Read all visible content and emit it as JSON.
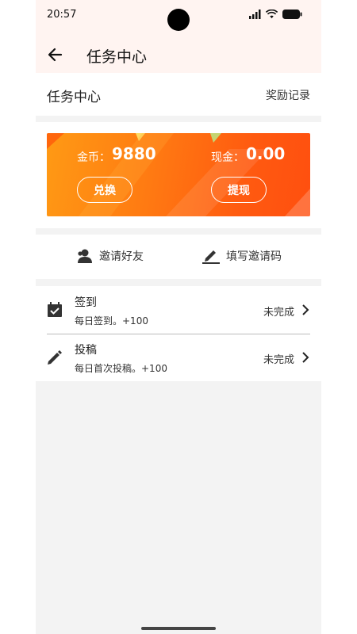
{
  "status_bar": {
    "time": "20:57"
  },
  "app_bar": {
    "title": "任务中心"
  },
  "header": {
    "title": "任务中心",
    "reward_link": "奖励记录"
  },
  "wallet": {
    "coin_label": "金币：",
    "coin_value": "9880",
    "cash_label": "现金：",
    "cash_value": "0.00",
    "exchange_button": "兑换",
    "withdraw_button": "提现",
    "gradient_colors": [
      "#ff9a14",
      "#ff4f0f"
    ]
  },
  "invite": {
    "friends_label": "邀请好友",
    "code_label": "填写邀请码"
  },
  "tasks": [
    {
      "title": "签到",
      "description": "每日签到。+100",
      "status": "未完成",
      "icon": "calendar-check-icon"
    },
    {
      "title": "投稿",
      "description": "每日首次投稿。+100",
      "status": "未完成",
      "icon": "pencil-icon"
    }
  ]
}
